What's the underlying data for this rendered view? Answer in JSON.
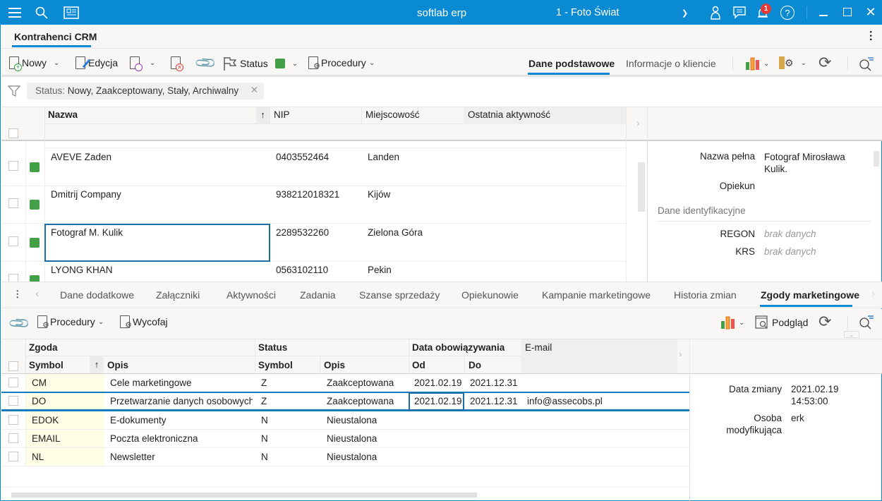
{
  "titlebar": {
    "app_name": "softlab erp",
    "company": "1 - Foto Świat",
    "notification_count": "1"
  },
  "module_tab": "Kontrahenci CRM",
  "toolbar": {
    "new": "Nowy",
    "edit": "Edycja",
    "status": "Status",
    "status_color": "#43a047",
    "procedures": "Procedury",
    "view_tabs": [
      "Dane podstawowe",
      "Informacje o kliencie"
    ]
  },
  "filter": {
    "label": "Status:",
    "value": "Nowy, Zaakceptowany, Stały, Archiwalny"
  },
  "grid": {
    "columns": [
      "Nazwa",
      "NIP",
      "Miejscowość",
      "Ostatnia aktywność"
    ],
    "rows": [
      {
        "name": "AVEVE Zaden",
        "nip": "0403552464",
        "city": "Landen"
      },
      {
        "name": "Dmitrij Company",
        "nip": "938212018321",
        "city": "Kijów"
      },
      {
        "name": "Fotograf M. Kulik",
        "nip": "2289532260",
        "city": "Zielona Góra"
      },
      {
        "name": "LYONG KHAN",
        "nip": "0563102110",
        "city": "Pekin"
      }
    ]
  },
  "details": {
    "full_name_label": "Nazwa pełna",
    "full_name": "Fotograf Mirosława Kulik.",
    "guardian_label": "Opiekun",
    "section": "Dane identyfikacyjne",
    "regon_label": "REGON",
    "regon": "brak danych",
    "krs_label": "KRS",
    "krs": "brak danych"
  },
  "subtabs": [
    "Dane dodatkowe",
    "Załączniki",
    "Aktywności",
    "Zadania",
    "Szanse sprzedaży",
    "Opiekunowie",
    "Kampanie marketingowe",
    "Historia zmian",
    "Zgody marketingowe"
  ],
  "toolbar2": {
    "procedures": "Procedury",
    "withdraw": "Wycofaj",
    "preview": "Podgląd"
  },
  "grid2": {
    "groups": {
      "consent": "Zgoda",
      "status": "Status",
      "validity": "Data obowiązywania",
      "email": "E-mail"
    },
    "columns": {
      "symbol": "Symbol",
      "desc": "Opis",
      "status_symbol": "Symbol",
      "status_desc": "Opis",
      "from": "Od",
      "to": "Do"
    },
    "rows": [
      {
        "symbol": "CM",
        "desc": "Cele marketingowe",
        "st": "Z",
        "st_desc": "Zaakceptowana",
        "from": "2021.02.19",
        "to": "2021.12.31",
        "email": ""
      },
      {
        "symbol": "DO",
        "desc": "Przetwarzanie danych osobowych",
        "st": "Z",
        "st_desc": "Zaakceptowana",
        "from": "2021.02.19",
        "to": "2021.12.31",
        "email": "info@assecobs.pl"
      },
      {
        "symbol": "EDOK",
        "desc": "E-dokumenty",
        "st": "N",
        "st_desc": "Nieustalona",
        "from": "",
        "to": "",
        "email": ""
      },
      {
        "symbol": "EMAIL",
        "desc": "Poczta elektroniczna",
        "st": "N",
        "st_desc": "Nieustalona",
        "from": "",
        "to": "",
        "email": ""
      },
      {
        "symbol": "NL",
        "desc": "Newsletter",
        "st": "N",
        "st_desc": "Nieustalona",
        "from": "",
        "to": "",
        "email": ""
      }
    ]
  },
  "details2": {
    "changed_label": "Data zmiany",
    "changed_date": "2021.02.19",
    "changed_time": "14:53:00",
    "person_label1": "Osoba",
    "person_label2": "modyfikująca",
    "person": "erk"
  }
}
